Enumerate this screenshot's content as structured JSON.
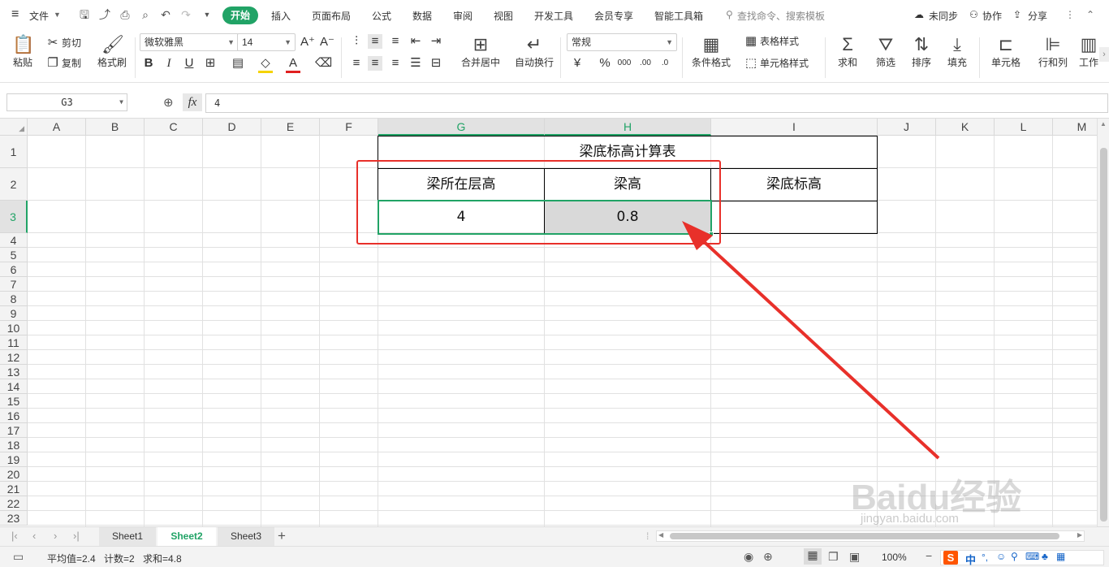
{
  "menubar": {
    "hamburger": "≡",
    "file_label": "文件",
    "tabs": [
      "开始",
      "插入",
      "页面布局",
      "公式",
      "数据",
      "审阅",
      "视图",
      "开发工具",
      "会员专享",
      "智能工具箱"
    ],
    "search_placeholder": "查找命令、搜索模板",
    "sync_label": "未同步",
    "collab_label": "协作",
    "share_label": "分享"
  },
  "ribbon": {
    "paste": "粘贴",
    "cut": "剪切",
    "copy": "复制",
    "format_painter": "格式刷",
    "font_name": "微软雅黑",
    "font_size": "14",
    "merge_center": "合并居中",
    "wrap_text": "自动换行",
    "number_format": "常规",
    "conditional_format": "条件格式",
    "table_style": "表格样式",
    "cell_style": "单元格样式",
    "sum": "求和",
    "filter": "筛选",
    "sort": "排序",
    "fill": "填充",
    "cells": "单元格",
    "rows_cols": "行和列",
    "worksheet": "工作"
  },
  "formula": {
    "name_box": "G3",
    "fx": "fx",
    "value": "4"
  },
  "columns": [
    "A",
    "B",
    "C",
    "D",
    "E",
    "F",
    "G",
    "H",
    "I",
    "J",
    "K",
    "L",
    "M"
  ],
  "rows": [
    "1",
    "2",
    "3",
    "4",
    "5",
    "6",
    "7",
    "8",
    "9",
    "10",
    "11",
    "12",
    "13",
    "14",
    "15",
    "16",
    "17",
    "18",
    "19",
    "20",
    "21",
    "22",
    "23"
  ],
  "table": {
    "title": "梁底标高计算表",
    "h1": "梁所在层高",
    "h2": "梁高",
    "h3": "梁底标高",
    "v1": "4",
    "v2": "0.8",
    "v3": ""
  },
  "sheets": {
    "tabs": [
      "Sheet1",
      "Sheet2",
      "Sheet3"
    ],
    "active": "Sheet2",
    "add": "+"
  },
  "status": {
    "average": "平均值=2.4",
    "count": "计数=2",
    "sum": "求和=4.8",
    "zoom": "100%"
  },
  "watermark": {
    "brand": "Baidu经验",
    "url": "jingyan.baidu.com"
  },
  "colors": {
    "accent": "#21a366",
    "annotation": "#e8302a",
    "highlight_fill": "#d9d9d9"
  }
}
